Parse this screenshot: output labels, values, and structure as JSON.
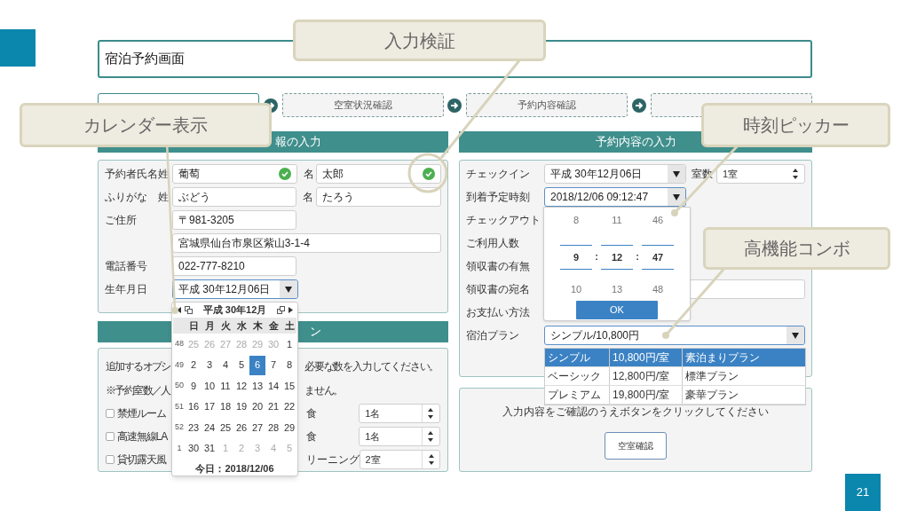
{
  "slide": {
    "page_number": "21"
  },
  "window": {
    "title": "宿泊予約画面"
  },
  "steps": [
    {
      "selected": true
    },
    {
      "label": "空室状況確認",
      "selected": false
    },
    {
      "label": "予約内容確認",
      "selected": false
    },
    {
      "selected": false
    }
  ],
  "guest_panel": {
    "title": "報の入力",
    "rows": [
      {
        "label": "予約者氏名",
        "fields": [
          {
            "prefix": "姓",
            "value": "葡萄",
            "valid": true
          },
          {
            "prefix": "名",
            "value": "太郎",
            "valid": true
          }
        ]
      },
      {
        "label": "ふりがな",
        "fields": [
          {
            "prefix": "姓",
            "value": "ぶどう",
            "valid": false
          },
          {
            "prefix": "名",
            "value": "たろう",
            "valid": false
          }
        ]
      },
      {
        "label": "ご住所",
        "fields": [
          {
            "kind": "short",
            "value": "〒981-3205"
          }
        ]
      },
      {
        "fields": [
          {
            "kind": "wide",
            "value": "宮城県仙台市泉区紫山3-1-4"
          }
        ]
      },
      {
        "label": "電話番号",
        "fields": [
          {
            "kind": "short",
            "value": "022-777-8210"
          }
        ]
      },
      {
        "label": "生年月日",
        "fields": [
          {
            "kind": "select",
            "value": "平成 30年12月06日",
            "focused": true
          }
        ]
      }
    ]
  },
  "calendar": {
    "month": "平成 30年12月",
    "weekdays": [
      "日",
      "月",
      "火",
      "水",
      "木",
      "金",
      "土"
    ],
    "weeks": [
      {
        "week": "48",
        "days": [
          {
            "d": "25",
            "muted": true,
            "selected": false
          },
          {
            "d": "26",
            "muted": true,
            "selected": false
          },
          {
            "d": "27",
            "muted": true,
            "selected": false
          },
          {
            "d": "28",
            "muted": true,
            "selected": false
          },
          {
            "d": "29",
            "muted": true,
            "selected": false
          },
          {
            "d": "30",
            "muted": true,
            "selected": false
          },
          {
            "d": "1",
            "muted": false,
            "selected": false
          }
        ]
      },
      {
        "week": "49",
        "days": [
          {
            "d": "2",
            "muted": false,
            "selected": false
          },
          {
            "d": "3",
            "muted": false,
            "selected": false
          },
          {
            "d": "4",
            "muted": false,
            "selected": false
          },
          {
            "d": "5",
            "muted": false,
            "selected": false
          },
          {
            "d": "6",
            "muted": false,
            "selected": true
          },
          {
            "d": "7",
            "muted": false,
            "selected": false
          },
          {
            "d": "8",
            "muted": false,
            "selected": false
          }
        ]
      },
      {
        "week": "50",
        "days": [
          {
            "d": "9",
            "muted": false,
            "selected": false
          },
          {
            "d": "10",
            "muted": false,
            "selected": false
          },
          {
            "d": "11",
            "muted": false,
            "selected": false
          },
          {
            "d": "12",
            "muted": false,
            "selected": false
          },
          {
            "d": "13",
            "muted": false,
            "selected": false
          },
          {
            "d": "14",
            "muted": false,
            "selected": false
          },
          {
            "d": "15",
            "muted": false,
            "selected": false
          }
        ]
      },
      {
        "week": "51",
        "days": [
          {
            "d": "16",
            "muted": false,
            "selected": false
          },
          {
            "d": "17",
            "muted": false,
            "selected": false
          },
          {
            "d": "18",
            "muted": false,
            "selected": false
          },
          {
            "d": "19",
            "muted": false,
            "selected": false
          },
          {
            "d": "20",
            "muted": false,
            "selected": false
          },
          {
            "d": "21",
            "muted": false,
            "selected": false
          },
          {
            "d": "22",
            "muted": false,
            "selected": false
          }
        ]
      },
      {
        "week": "52",
        "days": [
          {
            "d": "23",
            "muted": false,
            "selected": false
          },
          {
            "d": "24",
            "muted": false,
            "selected": false
          },
          {
            "d": "25",
            "muted": false,
            "selected": false
          },
          {
            "d": "26",
            "muted": false,
            "selected": false
          },
          {
            "d": "27",
            "muted": false,
            "selected": false
          },
          {
            "d": "28",
            "muted": false,
            "selected": false
          },
          {
            "d": "29",
            "muted": false,
            "selected": false
          }
        ]
      },
      {
        "week": "1",
        "days": [
          {
            "d": "30",
            "muted": false,
            "selected": false
          },
          {
            "d": "31",
            "muted": false,
            "selected": false
          },
          {
            "d": "1",
            "muted": true,
            "selected": false
          },
          {
            "d": "2",
            "muted": true,
            "selected": false
          },
          {
            "d": "3",
            "muted": true,
            "selected": false
          },
          {
            "d": "4",
            "muted": true,
            "selected": false
          },
          {
            "d": "5",
            "muted": true,
            "selected": false
          }
        ]
      }
    ],
    "today": "今日：2018/12/06"
  },
  "options_panel": {
    "title": "ン",
    "notes": [
      {
        "left": "追加するオプシ",
        "right": "必要な数を入力してください。"
      },
      {
        "left": "※予約室数／人",
        "right": "ません。"
      }
    ],
    "items": [
      {
        "label": "禁煙ルーム",
        "checked": false,
        "right_label": "食",
        "value": "1名"
      },
      {
        "label": "高速無線LA",
        "checked": false,
        "right_label": "食",
        "value": "1名"
      },
      {
        "label": "貸切露天風",
        "checked": false,
        "right_label": "リーニング",
        "value": "2室"
      }
    ]
  },
  "booking_panel": {
    "title": "予約内容の入力",
    "rows": [
      {
        "label": "チェックイン",
        "field": {
          "kind": "select",
          "value": "平成 30年12月06日",
          "focused": false
        },
        "extra": {
          "label": "室数",
          "value": "1室"
        }
      },
      {
        "label": "到着予定時刻",
        "field": {
          "kind": "select",
          "value": "2018/12/06 09:12:47",
          "focused": true
        }
      },
      {
        "label": "チェックアウト"
      },
      {
        "label": "ご利用人数"
      },
      {
        "label": "領収書の有無"
      },
      {
        "label": "領収書の宛名",
        "field": {
          "kind": "text"
        }
      },
      {
        "label": "お支払い方法"
      },
      {
        "label": "宿泊プラン",
        "field": {
          "kind": "combo",
          "value": "シンプル/10,800円",
          "focused": true
        }
      }
    ]
  },
  "time_picker": {
    "columns": [
      {
        "above": "8",
        "value": "9",
        "below": "10"
      },
      {
        "above": "11",
        "value": "12",
        "below": "13"
      },
      {
        "above": "46",
        "value": "47",
        "below": "48"
      }
    ],
    "separators": [
      ":",
      ":"
    ],
    "button": "OK"
  },
  "plan_dropdown": [
    {
      "cells": [
        "シンプル",
        "10,800円/室",
        "素泊まりプラン"
      ],
      "selected": true
    },
    {
      "cells": [
        "ベーシック",
        "12,800円/室",
        "標準プラン"
      ],
      "selected": false
    },
    {
      "cells": [
        "プレミアム",
        "19,800円/室",
        "豪華プラン"
      ],
      "selected": false
    }
  ],
  "confirm_panel": {
    "message": "入力内容をご確認のうえボタンをクリックしてください",
    "button": "空室確認"
  },
  "callouts": [
    "入力検証",
    "カレンダー表示",
    "時刻ピッカー",
    "高機能コンボ"
  ]
}
